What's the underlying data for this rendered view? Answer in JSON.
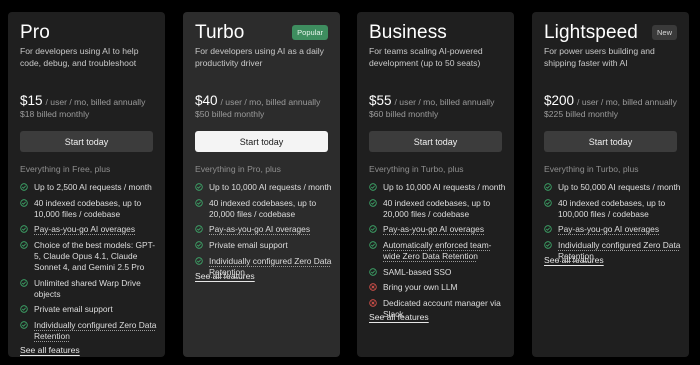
{
  "colors": {
    "page_bg": "#000000",
    "card_bg": "#1f1f1f",
    "card_highlight_bg": "#2c2c2c",
    "check_green": "#3fae6d",
    "cross_red": "#e2554e",
    "popular_badge_bg": "#3e8d5f"
  },
  "icons": {
    "included": "check-circle-icon",
    "excluded": "x-circle-icon"
  },
  "plans": [
    {
      "name": "Pro",
      "badge": "",
      "description": "For developers using AI to help code, debug, and troubleshoot",
      "price": "$15",
      "price_note": "/ user / mo, billed annually",
      "monthly": "$18 billed monthly",
      "cta": "Start today",
      "everything": "Everything in Free, plus",
      "features": [
        {
          "text": "Up to 2,500 AI requests / month",
          "icon": "check-circle-icon",
          "dotted": false
        },
        {
          "text": "40 indexed codebases, up to 10,000 files / codebase",
          "icon": "check-circle-icon",
          "dotted": false
        },
        {
          "text": "Pay-as-you-go AI overages",
          "icon": "check-circle-icon",
          "dotted": true
        },
        {
          "text": "Choice of the best models: GPT-5, Claude Opus 4.1, Claude Sonnet 4, and Gemini 2.5 Pro",
          "icon": "check-circle-icon",
          "dotted": false
        },
        {
          "text": "Unlimited shared Warp Drive objects",
          "icon": "check-circle-icon",
          "dotted": false
        },
        {
          "text": "Private email support",
          "icon": "check-circle-icon",
          "dotted": false
        },
        {
          "text": "Individually configured Zero Data Retention",
          "icon": "check-circle-icon",
          "dotted": true
        }
      ],
      "see_all": "See all features"
    },
    {
      "name": "Turbo",
      "badge": "Popular",
      "description": "For developers using AI as a daily productivity driver",
      "price": "$40",
      "price_note": "/ user / mo, billed annually",
      "monthly": "$50 billed monthly",
      "cta": "Start today",
      "everything": "Everything in Pro, plus",
      "features": [
        {
          "text": "Up to 10,000 AI requests / month",
          "icon": "check-circle-icon",
          "dotted": false
        },
        {
          "text": "40 indexed codebases, up to 20,000 files / codebase",
          "icon": "check-circle-icon",
          "dotted": false
        },
        {
          "text": "Pay-as-you-go AI overages",
          "icon": "check-circle-icon",
          "dotted": true
        },
        {
          "text": "Private email support",
          "icon": "check-circle-icon",
          "dotted": false
        },
        {
          "text": "Individually configured Zero Data Retention",
          "icon": "check-circle-icon",
          "dotted": true
        }
      ],
      "see_all": "See all features"
    },
    {
      "name": "Business",
      "badge": "",
      "description": "For teams scaling AI-powered development (up to 50 seats)",
      "price": "$55",
      "price_note": "/ user / mo, billed annually",
      "monthly": "$60 billed monthly",
      "cta": "Start today",
      "everything": "Everything in Turbo, plus",
      "features": [
        {
          "text": "Up to 10,000 AI requests / month",
          "icon": "check-circle-icon",
          "dotted": false
        },
        {
          "text": "40 indexed codebases, up to 20,000 files / codebase",
          "icon": "check-circle-icon",
          "dotted": false
        },
        {
          "text": "Pay-as-you-go AI overages",
          "icon": "check-circle-icon",
          "dotted": true
        },
        {
          "text": "Automatically enforced team-wide Zero Data Retention",
          "icon": "check-circle-icon",
          "dotted": true
        },
        {
          "text": "SAML-based SSO",
          "icon": "check-circle-icon",
          "dotted": false
        },
        {
          "text": "Bring your own LLM",
          "icon": "x-circle-icon",
          "dotted": false
        },
        {
          "text": "Dedicated account manager via Slack",
          "icon": "x-circle-icon",
          "dotted": false
        }
      ],
      "see_all": "See all features"
    },
    {
      "name": "Lightspeed",
      "badge": "New",
      "description": "For power users building and shipping faster with AI",
      "price": "$200",
      "price_note": "/ user / mo, billed annually",
      "monthly": "$225 billed monthly",
      "cta": "Start today",
      "everything": "Everything in Turbo, plus",
      "features": [
        {
          "text": "Up to 50,000 AI requests / month",
          "icon": "check-circle-icon",
          "dotted": false
        },
        {
          "text": "40 indexed codebases, up to 100,000 files / codebase",
          "icon": "check-circle-icon",
          "dotted": false
        },
        {
          "text": "Pay-as-you-go AI overages",
          "icon": "check-circle-icon",
          "dotted": true
        },
        {
          "text": "Individually configured Zero Data Retention",
          "icon": "check-circle-icon",
          "dotted": true
        }
      ],
      "see_all": "See all features"
    }
  ]
}
